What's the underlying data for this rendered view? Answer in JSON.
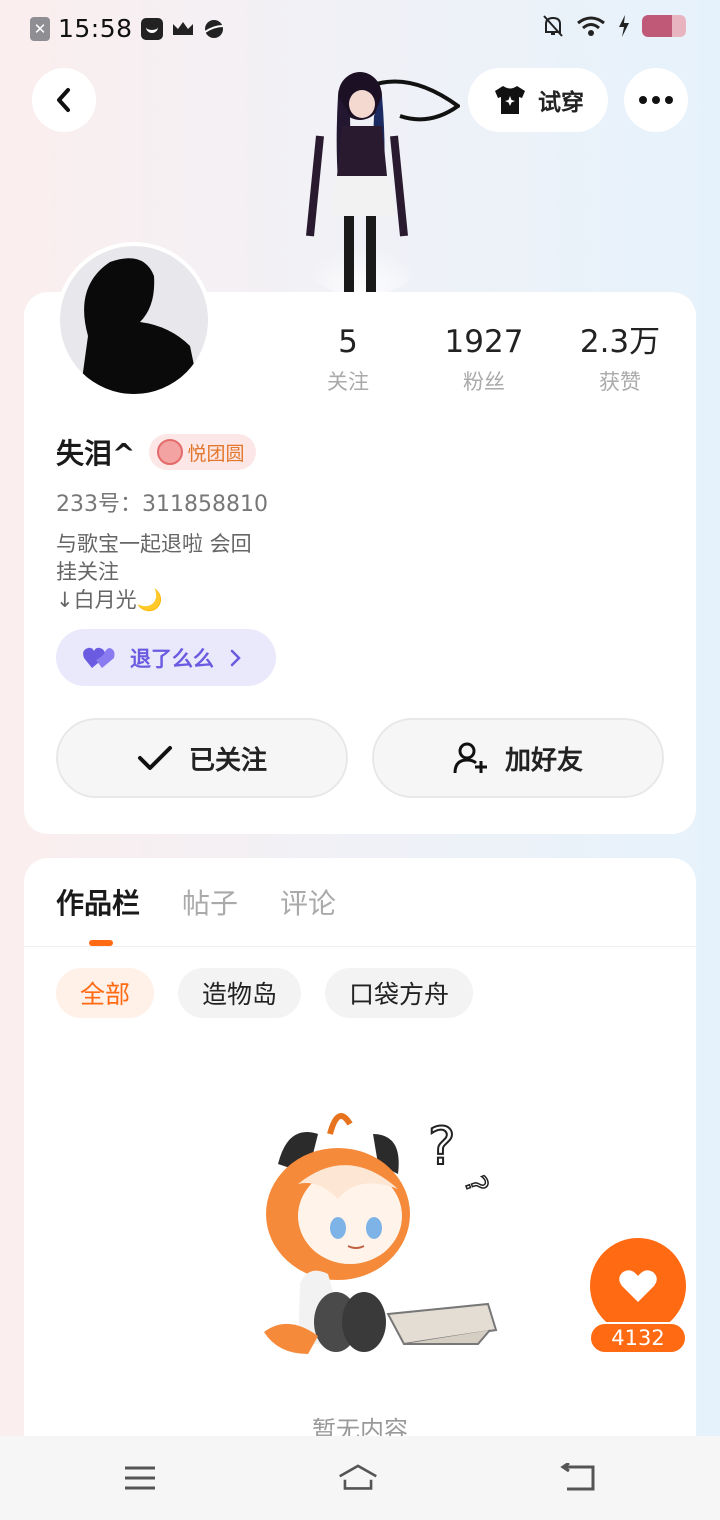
{
  "status_bar": {
    "time": "15:58",
    "left_icons": [
      "close-notification-icon",
      "message-icon",
      "crown-icon",
      "planet-icon"
    ],
    "right_icons": [
      "bell-off-icon",
      "wifi-icon",
      "charging-icon",
      "battery-icon"
    ]
  },
  "header": {
    "back_icon": "chevron-left-icon",
    "tryon_label": "试穿",
    "tryon_icon": "tshirt-icon",
    "more_icon": "more-dots-icon"
  },
  "profile": {
    "stats": [
      {
        "value": "5",
        "label": "关注"
      },
      {
        "value": "1927",
        "label": "粉丝"
      },
      {
        "value": "2.3万",
        "label": "获赞"
      }
    ],
    "username": "失泪^",
    "badge_label": "悦团圆",
    "uid": "233号：311858810",
    "bio_lines": [
      "与歌宝一起退啦 会回",
      "挂关注",
      "↓白月光🌙"
    ],
    "fan_pill_label": "退了么么",
    "follow_label": "已关注",
    "add_friend_label": "加好友"
  },
  "content": {
    "tabs": [
      "作品栏",
      "帖子",
      "评论"
    ],
    "active_tab": 0,
    "chips": [
      "全部",
      "造物岛",
      "口袋方舟"
    ],
    "active_chip": 0,
    "empty_text": "暂无内容",
    "like_count": "4132"
  },
  "colors": {
    "accent": "#ff6a13",
    "fan_purple": "#6b5be0"
  }
}
